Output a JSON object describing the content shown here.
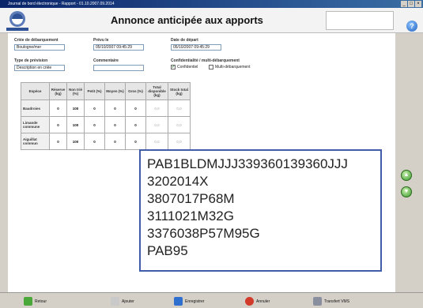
{
  "window": {
    "title": "Journal de bord électronique - Rapport - 01.10.2007.09.2014"
  },
  "header": {
    "title": "Annonce anticipée aux apports"
  },
  "form": {
    "crie_label": "Criée de débarquement",
    "crie_value": "Boulogne/mer",
    "prevu_label": "Prévu le",
    "prevu_value": "05/10/2007 09:45:29",
    "depart_label": "Date de départ",
    "depart_value": "05/10/2007 09:45:29",
    "type_label": "Type de prévision",
    "type_value": "Description en criée",
    "comment_label": "Commentaire",
    "comment_value": "",
    "conf_label": "Confidentialité / multi-débarquement",
    "chk1_label": "Confidentiel",
    "chk2_label": "Multi-débarquement"
  },
  "table": {
    "headers": [
      "Espèce",
      "Réserve (kg)",
      "Non trié (%)",
      "Petit (%)",
      "Moyen (%)",
      "Gros (%)",
      "Total disponible (kg)",
      "Stock total (kg)"
    ],
    "rows": [
      [
        "Baudroies",
        "0",
        "100",
        "0",
        "0",
        "0",
        "0,0",
        "0,0"
      ],
      [
        "Limande commune",
        "0",
        "100",
        "0",
        "0",
        "0",
        "0,0",
        "0,0"
      ],
      [
        "Aiguillat commun",
        "0",
        "100",
        "0",
        "0",
        "0",
        "0,0",
        "0,0"
      ]
    ]
  },
  "overlay_lines": [
    "PAB1BLDMJJJ339360139360JJJ",
    "3202014X",
    "3807017P68M",
    "3111021M32G",
    "3376038P57M95G",
    "PAB95"
  ],
  "bottom_buttons": [
    {
      "label": "Retour",
      "color": "#4aa83a"
    },
    {
      "label": "Ajouter",
      "color": "#c9c9c9"
    },
    {
      "label": "Enregistrer",
      "color": "#2f6fd0"
    },
    {
      "label": "Annuler",
      "color": "#d23a2a"
    },
    {
      "label": "Transfert VMS",
      "color": "#8a8fa0"
    }
  ]
}
